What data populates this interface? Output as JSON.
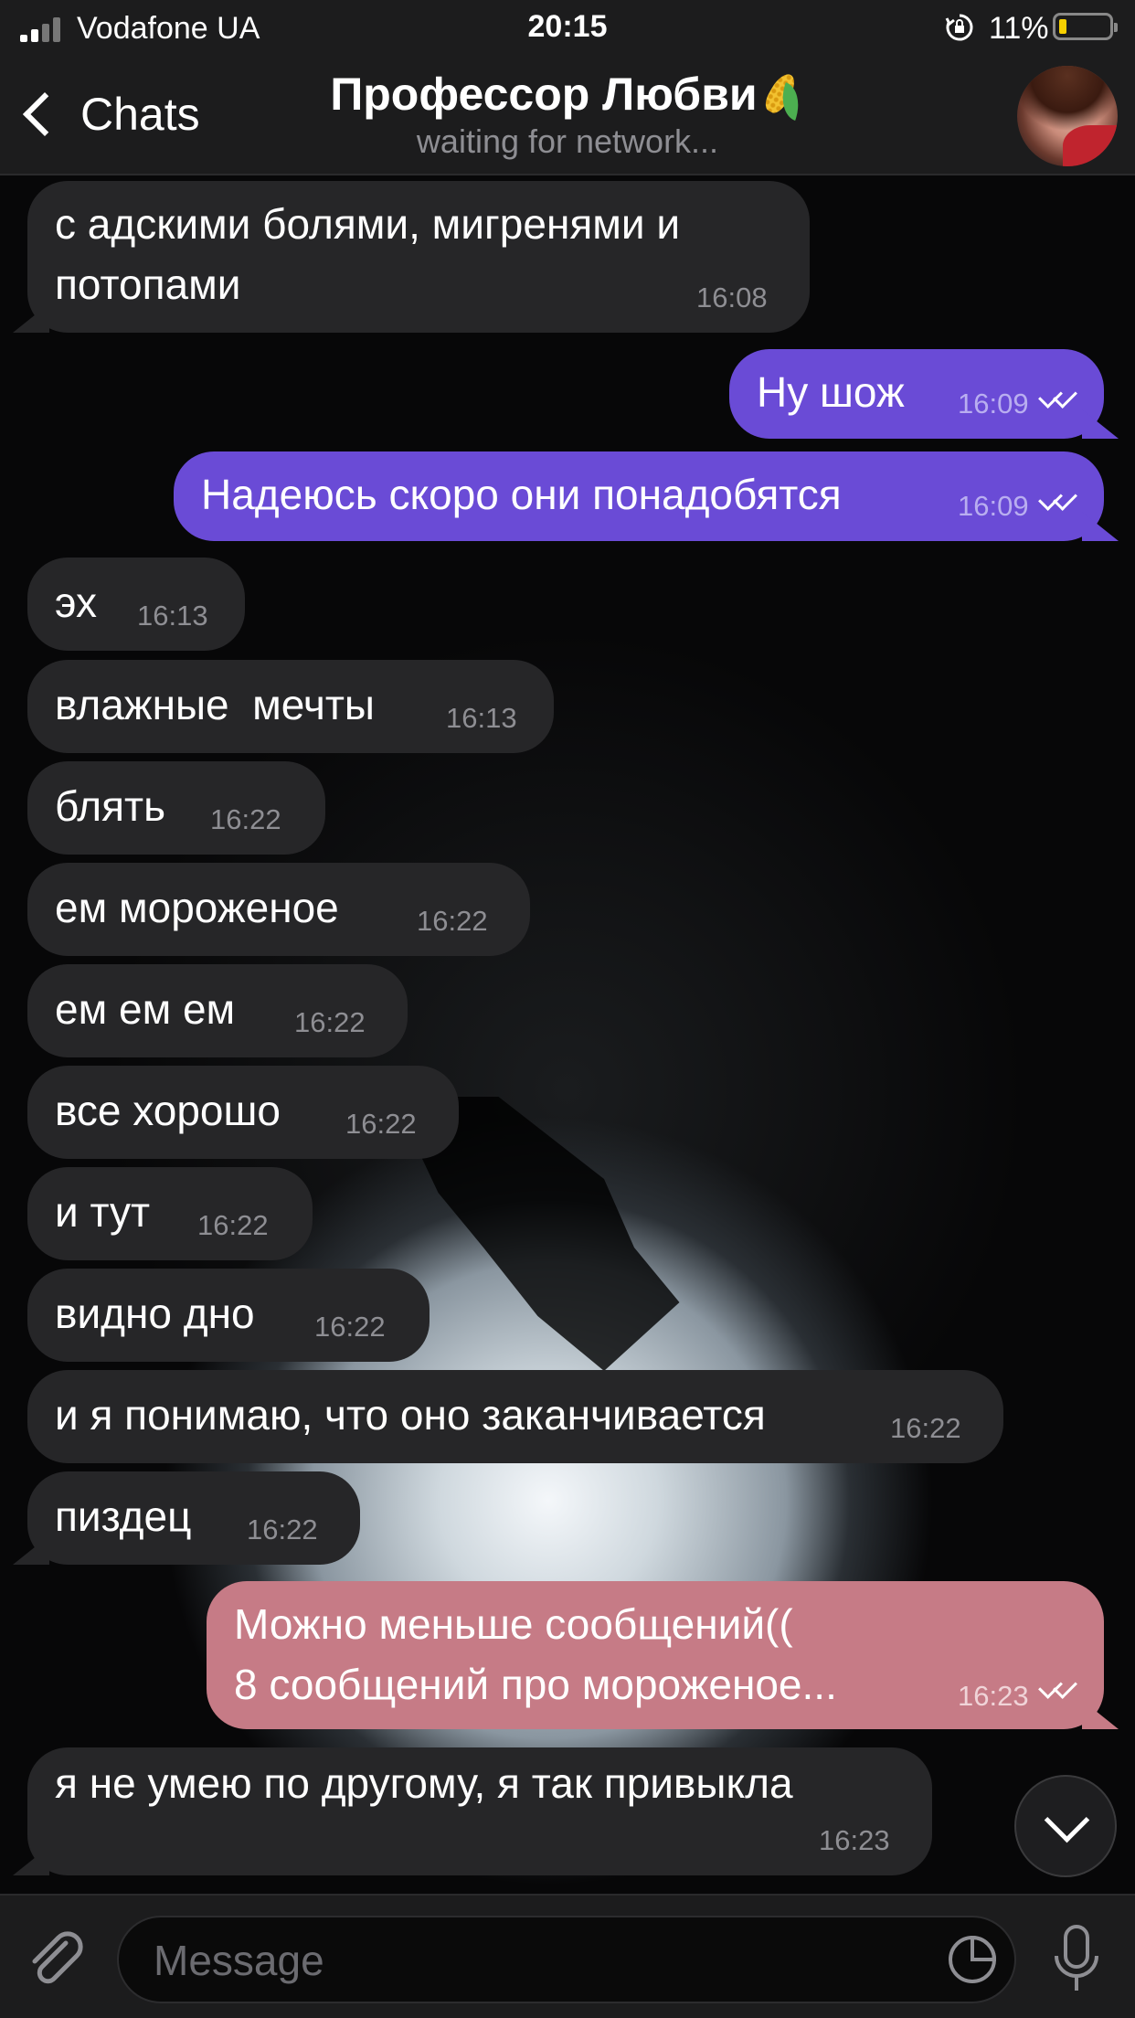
{
  "status_bar": {
    "carrier": "Vodafone UA",
    "time": "20:15",
    "battery_percent": "11%",
    "battery_level": 0.11
  },
  "nav": {
    "back_label": "Chats",
    "title": "Профессор Любви",
    "title_emoji": "corn-emoji",
    "subtitle": "waiting for network..."
  },
  "messages": [
    {
      "direction": "in",
      "text": "с адскими болями, мигренями и\nпотопами",
      "time": "16:08"
    },
    {
      "direction": "out",
      "text": "Ну шож",
      "time": "16:09",
      "read": true
    },
    {
      "direction": "out",
      "text": "Надеюсь скоро они понадобятся",
      "time": "16:09",
      "read": true
    },
    {
      "direction": "in",
      "text": "эх",
      "time": "16:13"
    },
    {
      "direction": "in",
      "text": "влажные  мечты",
      "time": "16:13"
    },
    {
      "direction": "in",
      "text": "блять",
      "time": "16:22"
    },
    {
      "direction": "in",
      "text": "ем мороженое",
      "time": "16:22"
    },
    {
      "direction": "in",
      "text": "ем ем ем",
      "time": "16:22"
    },
    {
      "direction": "in",
      "text": "все хорошо",
      "time": "16:22"
    },
    {
      "direction": "in",
      "text": "и тут",
      "time": "16:22"
    },
    {
      "direction": "in",
      "text": "видно дно",
      "time": "16:22"
    },
    {
      "direction": "in",
      "text": "и я понимаю, что оно заканчивается",
      "time": "16:22"
    },
    {
      "direction": "in",
      "text": "пиздец",
      "time": "16:22"
    },
    {
      "direction": "out",
      "text": "Можно меньше сообщений((\n8 сообщений про мороженое...",
      "time": "16:23",
      "read": true
    },
    {
      "direction": "in",
      "text": "я не умею по другому, я так привыкла",
      "time": "16:23"
    }
  ],
  "input": {
    "placeholder": "Message"
  },
  "colors": {
    "outgoing_bubble": "#6a4bd6",
    "outgoing_bubble_highlight": "#c67b86",
    "incoming_bubble": "#262628",
    "bar_background": "#1c1c1d",
    "battery_low": "#f7d000"
  },
  "icons": [
    "signal-icon",
    "rotation-lock-icon",
    "battery-icon",
    "back-chevron-icon",
    "avatar",
    "scroll-down-icon",
    "attach-icon",
    "sticker-icon",
    "mic-icon",
    "read-ticks-icon"
  ]
}
